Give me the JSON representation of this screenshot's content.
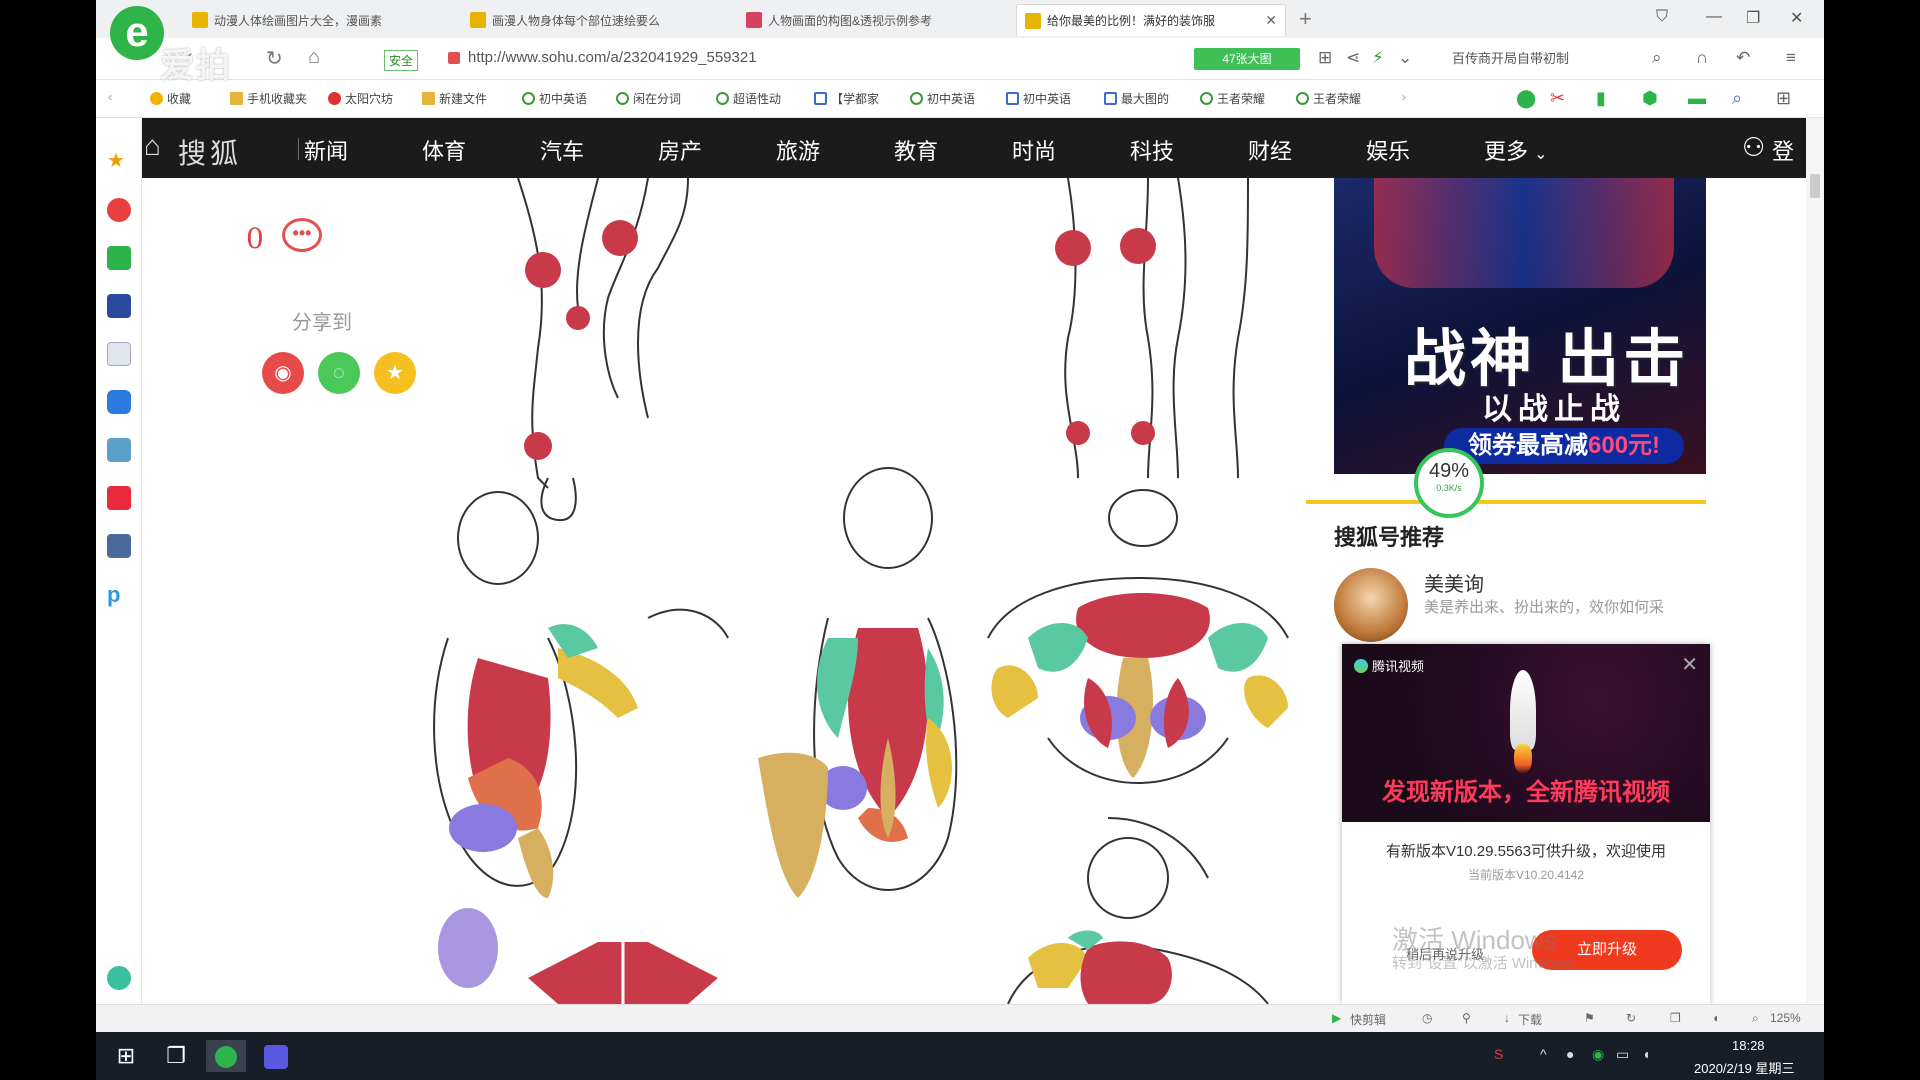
{
  "browser": {
    "tabs": [
      {
        "title": "动漫人体绘画图片大全，漫画素",
        "active": false
      },
      {
        "title": "画漫人物身体每个部位速绘要么",
        "active": false
      },
      {
        "title": "人物画面的构图&透视示例参考",
        "active": false
      },
      {
        "title": "给你最美的比例！满好的装饰服",
        "active": true
      }
    ],
    "logo_text": "爱拍",
    "secure_label": "安全",
    "url": "http://www.sohu.com/a/232041929_559321",
    "big_image_btn": "47张大图",
    "search_text": "百传商开局自带初制",
    "bookmarks": [
      "收藏",
      "手机收藏夹",
      "太阳穴坊",
      "新建文件",
      "初中英语",
      "闲在分词",
      "超语性动",
      "【学都家",
      "初中英语",
      "初中英语",
      "最大图的",
      "王者荣耀",
      "王者荣耀"
    ]
  },
  "sohu": {
    "logo": "搜狐",
    "nav": [
      "新闻",
      "体育",
      "汽车",
      "房产",
      "旅游",
      "教育",
      "时尚",
      "科技",
      "财经",
      "娱乐",
      "更多"
    ],
    "login": "登"
  },
  "article": {
    "comment_count": "0",
    "share_label": "分享到"
  },
  "ad": {
    "title": "战神 出击",
    "subtitle": "以战止战",
    "coupon_prefix": "领券最高减",
    "coupon_amount": "600元!"
  },
  "speed": {
    "percent": "49%",
    "rate": "0.3K/s"
  },
  "recommend": {
    "title": "搜狐号推荐",
    "name": "美美询",
    "desc": "美是养出来、扮出来的，效你如何采"
  },
  "popup": {
    "app_name": "腾讯视频",
    "headline": "发现新版本，全新腾讯视频",
    "message": "有新版本V10.29.5563可供升级，欢迎使用",
    "current": "当前版本V10.20.4142",
    "later": "稍后再说升级",
    "upgrade": "立即升级"
  },
  "watermark": {
    "line1": "激活 Windows",
    "line2": "转到\"设置\"以激活 Windows。"
  },
  "statusbar": {
    "quick": "快剪辑",
    "download": "下载",
    "zoom": "125%"
  },
  "taskbar": {
    "time": "18:28",
    "date": "2020/2/19 星期三"
  }
}
